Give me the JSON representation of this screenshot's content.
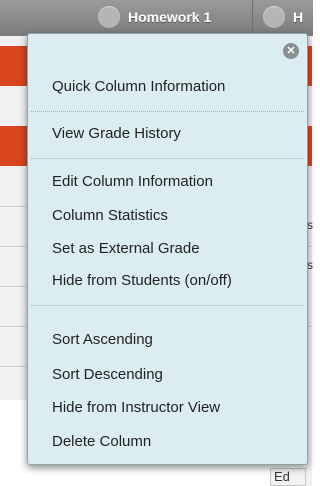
{
  "header": {
    "columns": [
      {
        "label": "Homework 1"
      },
      {
        "label": "H"
      }
    ]
  },
  "background": {
    "edit_fragment": "Ed",
    "right_fragments": [
      "s",
      "s"
    ]
  },
  "menu": {
    "close_icon": "close-icon",
    "items": [
      {
        "label": "Quick Column Information"
      },
      {
        "label": "View Grade History"
      },
      {
        "label": "Edit Column Information"
      },
      {
        "label": "Column Statistics"
      },
      {
        "label": "Set as External Grade"
      },
      {
        "label": "Hide from Students (on/off)"
      },
      {
        "label": "Sort Ascending"
      },
      {
        "label": "Sort Descending"
      },
      {
        "label": "Hide from Instructor View"
      },
      {
        "label": "Delete Column"
      }
    ]
  },
  "colors": {
    "menu_bg": "#dcedf1",
    "accent_orange": "#d9451e",
    "header_gray": "#8a8a8a"
  }
}
